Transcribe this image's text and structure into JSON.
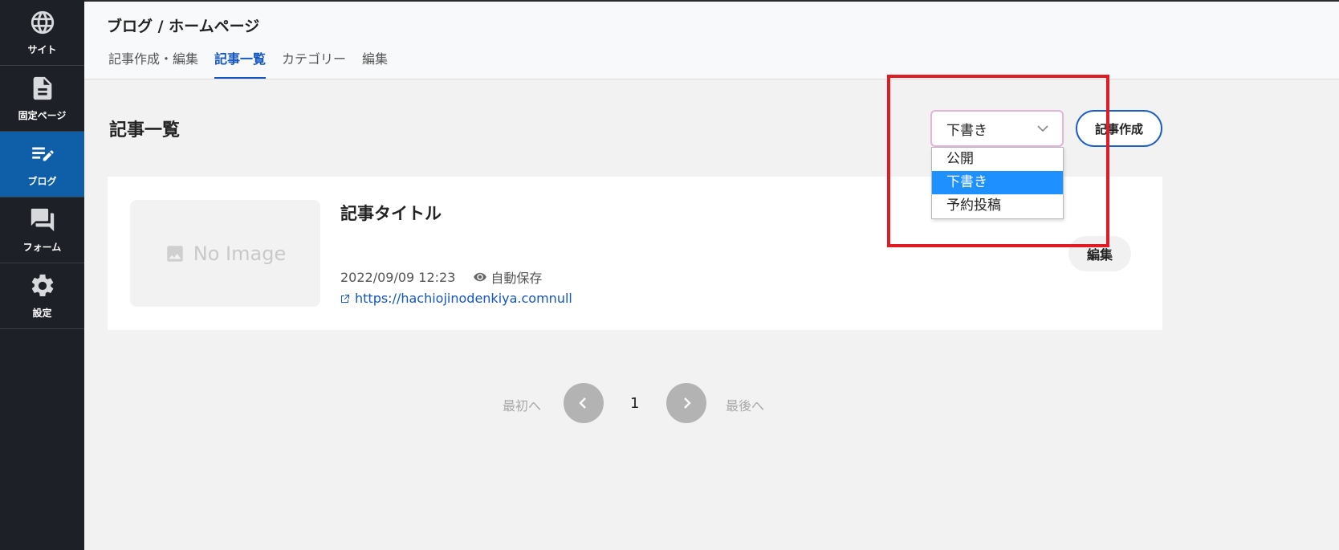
{
  "sidebar": {
    "items": [
      {
        "label": "サイト",
        "icon": "globe-icon"
      },
      {
        "label": "固定ページ",
        "icon": "document-icon"
      },
      {
        "label": "ブログ",
        "icon": "blog-edit-icon"
      },
      {
        "label": "フォーム",
        "icon": "chat-icon"
      },
      {
        "label": "設定",
        "icon": "gear-icon"
      }
    ],
    "active_index": 2
  },
  "header": {
    "breadcrumb": "ブログ / ホームページ",
    "tabs": [
      {
        "label": "記事作成・編集"
      },
      {
        "label": "記事一覧"
      },
      {
        "label": "カテゴリー"
      },
      {
        "label": "編集"
      }
    ],
    "active_tab_index": 1
  },
  "main": {
    "title": "記事一覧",
    "status_select": {
      "value": "下書き",
      "options": [
        "公開",
        "下書き",
        "予約投稿"
      ],
      "selected_index": 1
    },
    "create_button": "記事作成",
    "articles": [
      {
        "thumbnail_text": "No Image",
        "title": "記事タイトル",
        "datetime": "2022/09/09 12:23",
        "status_label": "自動保存",
        "url": "https://hachiojinodenkiya.comnull",
        "edit_label": "編集"
      }
    ],
    "pagination": {
      "first_label": "最初へ",
      "current_page": "1",
      "last_label": "最後へ"
    }
  },
  "colors": {
    "sidebar_bg": "#1e2027",
    "sidebar_active": "#0f5fa8",
    "accent_blue": "#1456c0",
    "highlight_red": "#e01b24",
    "option_selected": "#1e90ff"
  }
}
